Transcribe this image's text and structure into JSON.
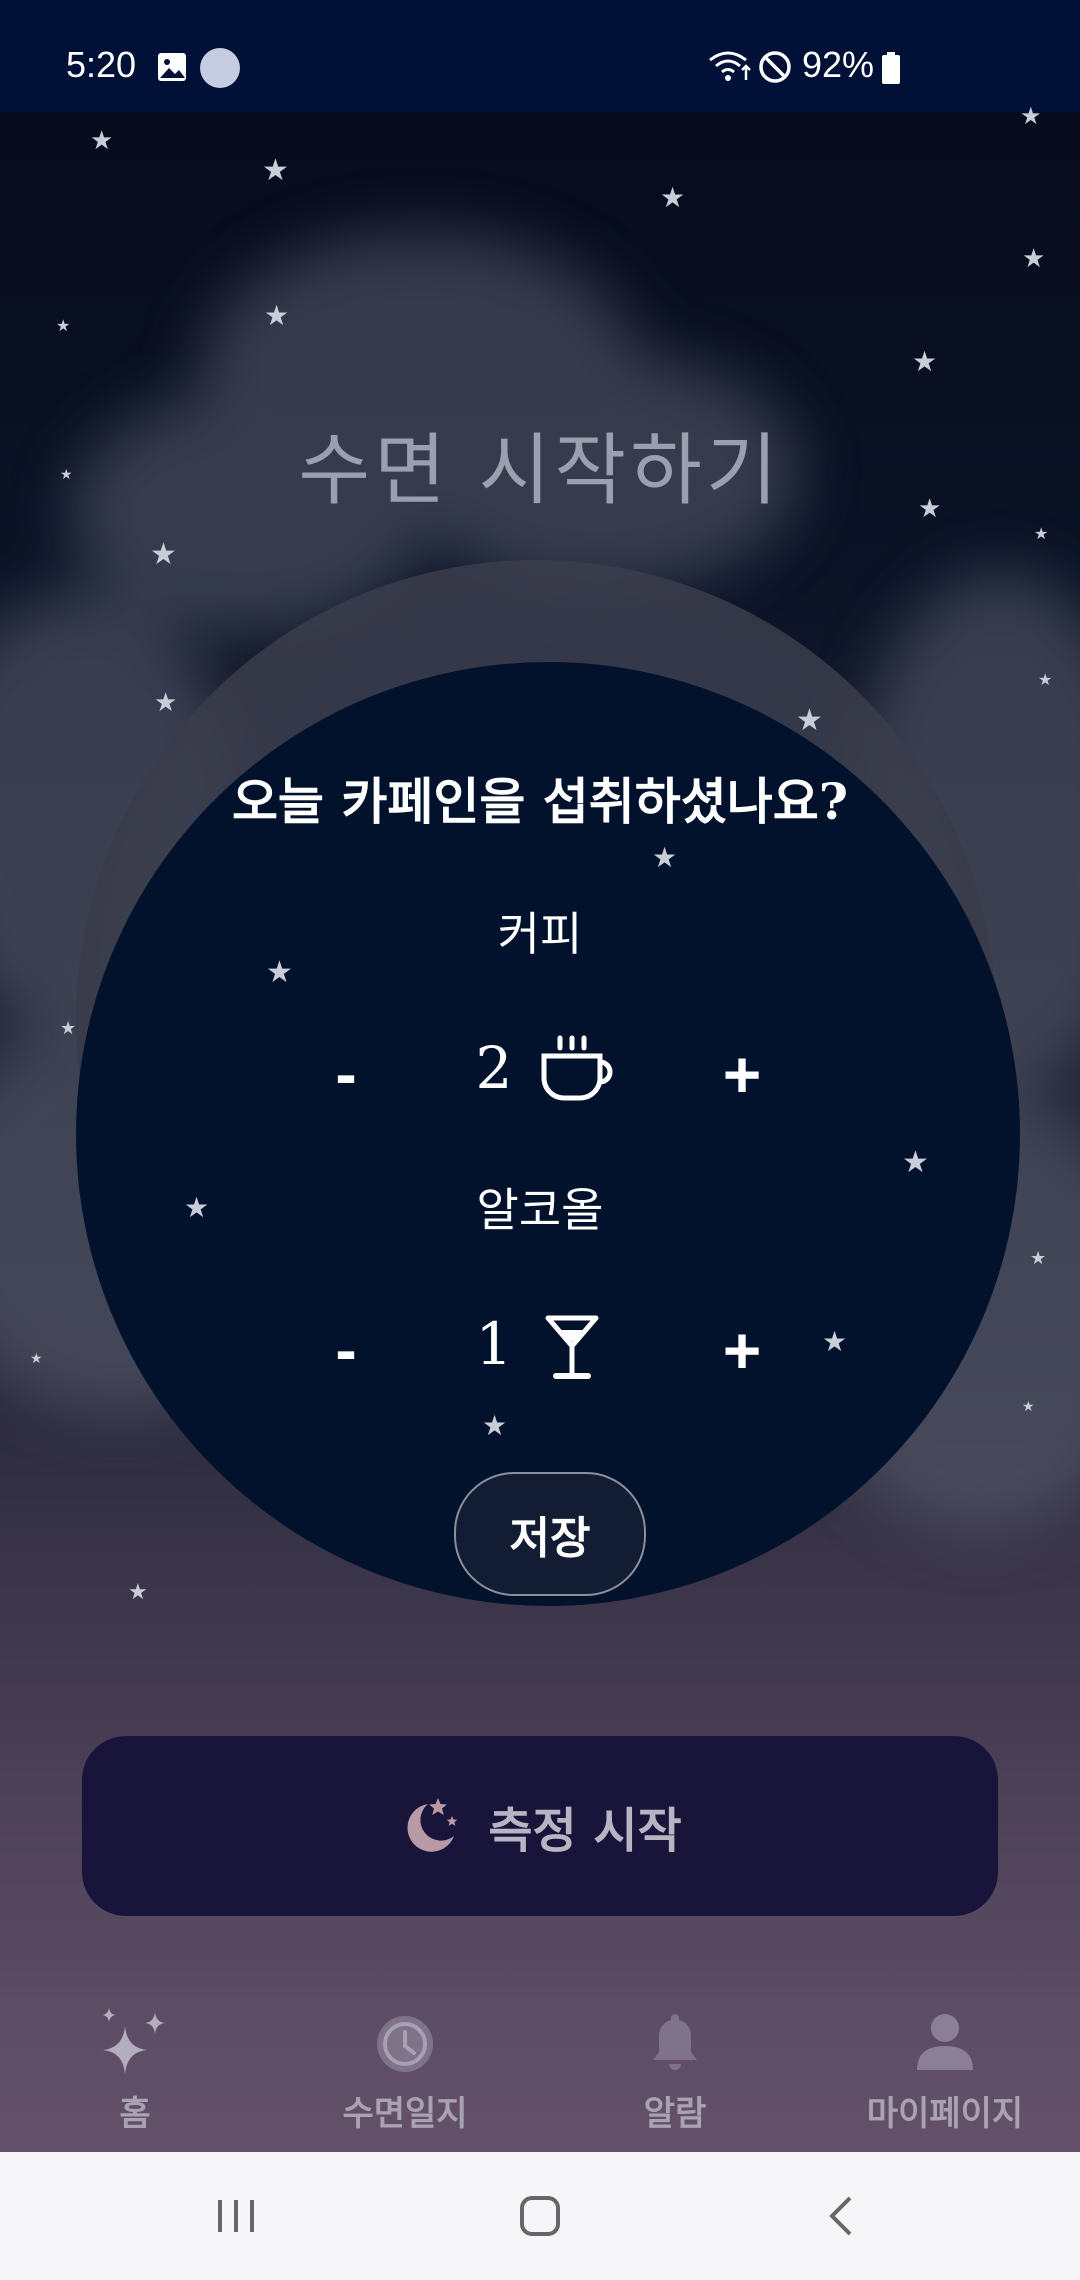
{
  "status_bar": {
    "time": "5:20",
    "battery_percent": "92%",
    "icons": [
      "image-icon",
      "app-notification-icon",
      "wifi-icon",
      "do-not-disturb-icon",
      "battery-icon"
    ]
  },
  "title": "수면 시작하기",
  "caffeine_card": {
    "question": "오늘 카페인을 섭취하셨나요?",
    "coffee": {
      "label": "커피",
      "count": "2",
      "minus": "-",
      "plus": "+",
      "icon": "coffee-cup-icon"
    },
    "alcohol": {
      "label": "알코올",
      "count": "1",
      "minus": "-",
      "plus": "+",
      "icon": "cocktail-glass-icon"
    },
    "save_label": "저장"
  },
  "start_button": {
    "label": "측정 시작",
    "icon": "moon-stars-icon"
  },
  "bottom_nav": {
    "items": [
      {
        "label": "홈",
        "icon": "sparkles-icon"
      },
      {
        "label": "수면일지",
        "icon": "clock-icon"
      },
      {
        "label": "알람",
        "icon": "bell-icon"
      },
      {
        "label": "마이페이지",
        "icon": "person-icon"
      }
    ]
  },
  "system_nav": {
    "icons": [
      "recent-apps-icon",
      "home-icon",
      "back-icon"
    ]
  },
  "colors": {
    "status_bar": "#001036",
    "card": "#02122c",
    "start_button": "#18143a",
    "nav_label": "#a9a2b3"
  }
}
